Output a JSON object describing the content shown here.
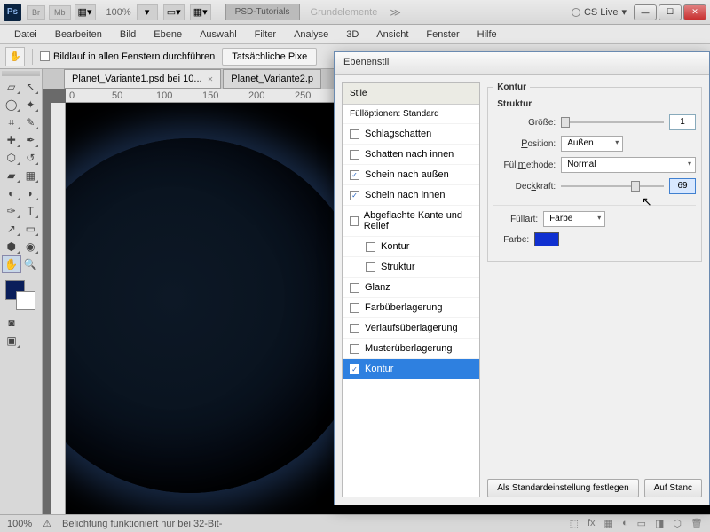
{
  "title": {
    "ps": "Ps",
    "boxes": [
      "Br",
      "Mb"
    ],
    "zoom": "100%",
    "psd_tut": "PSD-Tutorials",
    "grundel": "Grundelemente",
    "cslive": "CS Live"
  },
  "menu": [
    "Datei",
    "Bearbeiten",
    "Bild",
    "Ebene",
    "Auswahl",
    "Filter",
    "Analyse",
    "3D",
    "Ansicht",
    "Fenster",
    "Hilfe"
  ],
  "optbar": {
    "scroll_all": "Bildlauf in allen Fenstern durchführen",
    "actual": "Tatsächliche Pixe"
  },
  "tabs": [
    {
      "label": "Planet_Variante1.psd bei 10...",
      "active": true
    },
    {
      "label": "Planet_Variante2.p",
      "active": false
    }
  ],
  "ruler_marks": [
    "0",
    "50",
    "100",
    "150",
    "200",
    "250"
  ],
  "dialog": {
    "title": "Ebenenstil",
    "styles_hdr": "Stile",
    "styles": [
      {
        "label": "Füllöptionen: Standard",
        "cb": null,
        "sub": false
      },
      {
        "label": "Schlagschatten",
        "cb": false,
        "sub": false
      },
      {
        "label": "Schatten nach innen",
        "cb": false,
        "sub": false
      },
      {
        "label": "Schein nach außen",
        "cb": true,
        "sub": false
      },
      {
        "label": "Schein nach innen",
        "cb": true,
        "sub": false
      },
      {
        "label": "Abgeflachte Kante und Relief",
        "cb": false,
        "sub": false
      },
      {
        "label": "Kontur",
        "cb": false,
        "sub": true
      },
      {
        "label": "Struktur",
        "cb": false,
        "sub": true
      },
      {
        "label": "Glanz",
        "cb": false,
        "sub": false
      },
      {
        "label": "Farbüberlagerung",
        "cb": false,
        "sub": false
      },
      {
        "label": "Verlaufsüberlagerung",
        "cb": false,
        "sub": false
      },
      {
        "label": "Musterüberlagerung",
        "cb": false,
        "sub": false
      },
      {
        "label": "Kontur",
        "cb": true,
        "sub": false,
        "sel": true
      }
    ],
    "kontur_hdr": "Kontur",
    "struktur_hdr": "Struktur",
    "groesse_lbl": "Größe:",
    "groesse_val": "1",
    "position_lbl": "Position:",
    "position_val": "Außen",
    "fuellm_lbl": "Füllmethode:",
    "fuellm_val": "Normal",
    "deckkraft_lbl": "Deckkraft:",
    "deckkraft_val": "69",
    "fuellart_lbl": "Füllart:",
    "fuellart_val": "Farbe",
    "farbe_lbl": "Farbe:",
    "btn_default": "Als Standardeinstellung festlegen",
    "btn_reset": "Auf Stanc"
  },
  "status": {
    "zoom": "100%",
    "msg": "Belichtung funktioniert nur bei 32-Bit-"
  }
}
